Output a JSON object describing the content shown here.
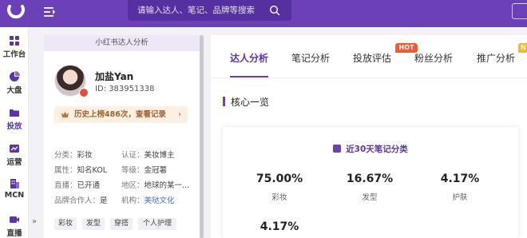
{
  "header": {
    "search_placeholder": "请输入达人、笔记、品牌等搜索"
  },
  "nav": {
    "items": [
      {
        "label": "工作台",
        "icon": "grid-icon"
      },
      {
        "label": "大盘",
        "icon": "pie-chart-icon"
      },
      {
        "label": "投放",
        "icon": "folder-icon"
      },
      {
        "label": "运营",
        "icon": "chart-card-icon"
      },
      {
        "label": "MCN",
        "icon": "building-icon"
      },
      {
        "label": "直播",
        "icon": "video-icon"
      }
    ],
    "collapse_label": "»"
  },
  "profile": {
    "panel_title": "小红书达人分析",
    "name": "加盐Yan",
    "id_text": "ID:  383951338",
    "history_text": "历史上榜486次，查看记录",
    "history_arrow": "›",
    "info": [
      {
        "key": "分类：",
        "value": "彩妆"
      },
      {
        "key": "认证：",
        "value": "美妆博主"
      },
      {
        "key": "属性：",
        "value": "知名KOL"
      },
      {
        "key": "等级：",
        "value": "金冠薯"
      },
      {
        "key": "直播：",
        "value": "已开通"
      },
      {
        "key": "地区：",
        "value": "地球的某一..."
      },
      {
        "key": "品牌合作人：",
        "value": "是"
      },
      {
        "key": "机构：",
        "value": "美哒文化"
      }
    ],
    "tags": [
      "彩妆",
      "发型",
      "穿搭",
      "个人护理"
    ]
  },
  "tabs": [
    {
      "label": "达人分析"
    },
    {
      "label": "笔记分析"
    },
    {
      "label": "投放评估"
    },
    {
      "label": "粉丝分析"
    },
    {
      "label": "推广分析"
    }
  ],
  "badges": {
    "hot": "HOT",
    "new": "N"
  },
  "overview": {
    "section_title": "核心一览",
    "card_title": "近30天笔记分类",
    "stats": [
      {
        "value": "75.00%",
        "label": "彩妆"
      },
      {
        "value": "16.67%",
        "label": "发型"
      },
      {
        "value": "4.17%",
        "label": "护肤"
      },
      {
        "value": "4.17%",
        "label": ""
      }
    ]
  },
  "colors": {
    "brand": "#6b40b8",
    "hot": "#f35a30",
    "new": "#f5b93a",
    "history": "#a0622f",
    "link": "#4a6fc7"
  }
}
